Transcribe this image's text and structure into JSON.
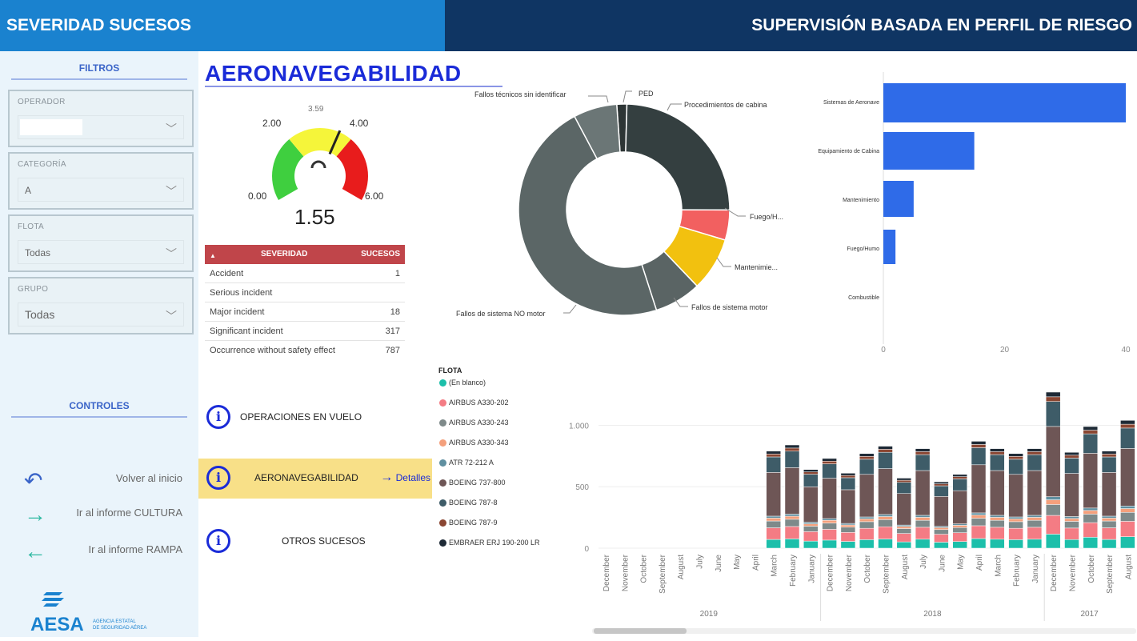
{
  "header": {
    "left_title": "SEVERIDAD SUCESOS",
    "right_title": "SUPERVISIÓN BASADA EN PERFIL DE RIESGO",
    "left_color": "#1a82cf",
    "right_color": "#0f3563"
  },
  "sidebar": {
    "filters_title": "FILTROS",
    "filters": [
      {
        "label": "OPERADOR",
        "value": ""
      },
      {
        "label": "CATEGORÍA",
        "value": "A"
      },
      {
        "label": "FLOTA",
        "value": "Todas"
      },
      {
        "label": "GRUPO",
        "value": "Todas"
      }
    ],
    "controls_title": "CONTROLES",
    "controls": [
      {
        "label": "Volver al inicio",
        "icon": "undo-arrow-icon"
      },
      {
        "label": "Ir al informe CULTURA",
        "icon": "arrow-right-icon"
      },
      {
        "label": "Ir al informe RAMPA",
        "icon": "arrow-left-icon"
      }
    ],
    "logo": {
      "text": "AESA",
      "subtitle_line1": "AGENCIA ESTATAL",
      "subtitle_line2": "DE SEGURIDAD AÉREA"
    }
  },
  "main": {
    "title": "AERONAVEGABILIDAD",
    "gauge": {
      "min": "0.00",
      "max": "6.00",
      "value": "1.55",
      "low_mark": "2.00",
      "high_mark": "4.00",
      "target": "3.59",
      "colors": {
        "green": "#3fcf3f",
        "yellow": "#f5f53a",
        "red": "#e81c1c"
      }
    },
    "severity_table": {
      "headers": [
        "SEVERIDAD",
        "SUCESOS"
      ],
      "rows": [
        {
          "name": "Accident",
          "value": "1"
        },
        {
          "name": "Serious incident",
          "value": ""
        },
        {
          "name": "Major incident",
          "value": "18"
        },
        {
          "name": "Significant incident",
          "value": "317"
        },
        {
          "name": "Occurrence without safety effect",
          "value": "787"
        }
      ]
    },
    "nav": [
      {
        "label": "OPERACIONES EN VUELO",
        "active": false
      },
      {
        "label": "AERONAVEGABILIDAD",
        "active": true,
        "details": "Detalles"
      },
      {
        "label": "OTROS SUCESOS",
        "active": false
      }
    ]
  },
  "chart_data": [
    {
      "type": "pie",
      "donut": true,
      "labels": [
        "PED",
        "Procedimientos de cabina",
        "Fuego/H...",
        "Mantenimie...",
        "Fallos de sistema motor",
        "Fallos de sistema NO motor",
        "Fallos técnicos sin identificar"
      ],
      "values": [
        1.5,
        24,
        4.5,
        8,
        7,
        46,
        6.5
      ],
      "colors": [
        "#2d3535",
        "#343f40",
        "#f26060",
        "#f2c10f",
        "#5a6464",
        "#5b6666",
        "#6b7676"
      ]
    },
    {
      "type": "bar",
      "orientation": "horizontal",
      "categories": [
        "Sistemas de Aeronave",
        "Equipamiento de Cabina",
        "Mantenimiento",
        "Fuego/Humo",
        "Combustible"
      ],
      "values": [
        40,
        15,
        5,
        2,
        0
      ],
      "xticks": [
        "0",
        "20",
        "40"
      ],
      "xlim": [
        0,
        40
      ],
      "color": "#2f6be8"
    },
    {
      "type": "bar",
      "stacked": true,
      "legend_title": "FLOTA",
      "series_names": [
        "(En blanco)",
        "AIRBUS A330-202",
        "AIRBUS A330-243",
        "AIRBUS A330-343",
        "ATR 72-212 A",
        "BOEING 737-800",
        "BOEING 787-8",
        "BOEING 787-9",
        "EMBRAER ERJ 190-200 LR"
      ],
      "series_colors": [
        "#1cbfaa",
        "#f47c84",
        "#7e8a8a",
        "#f4a07c",
        "#5f8fa0",
        "#6e5656",
        "#3e5c68",
        "#8a4632",
        "#1e2a36"
      ],
      "categories": [
        "December",
        "November",
        "October",
        "September",
        "August",
        "July",
        "June",
        "May",
        "April",
        "March",
        "February",
        "January",
        "December",
        "November",
        "October",
        "September",
        "August",
        "July",
        "June",
        "May",
        "April",
        "March",
        "February",
        "January",
        "December",
        "November",
        "October",
        "September",
        "August"
      ],
      "years": [
        "2019",
        "2018",
        "2017"
      ],
      "totals": [
        0,
        0,
        0,
        0,
        0,
        0,
        0,
        0,
        0,
        790,
        840,
        640,
        730,
        610,
        770,
        830,
        570,
        810,
        540,
        600,
        870,
        810,
        770,
        810,
        1270,
        780,
        990,
        790,
        1040
      ],
      "yticks": [
        "0",
        "500",
        "1.000"
      ],
      "ylim": [
        0,
        1270
      ]
    }
  ]
}
